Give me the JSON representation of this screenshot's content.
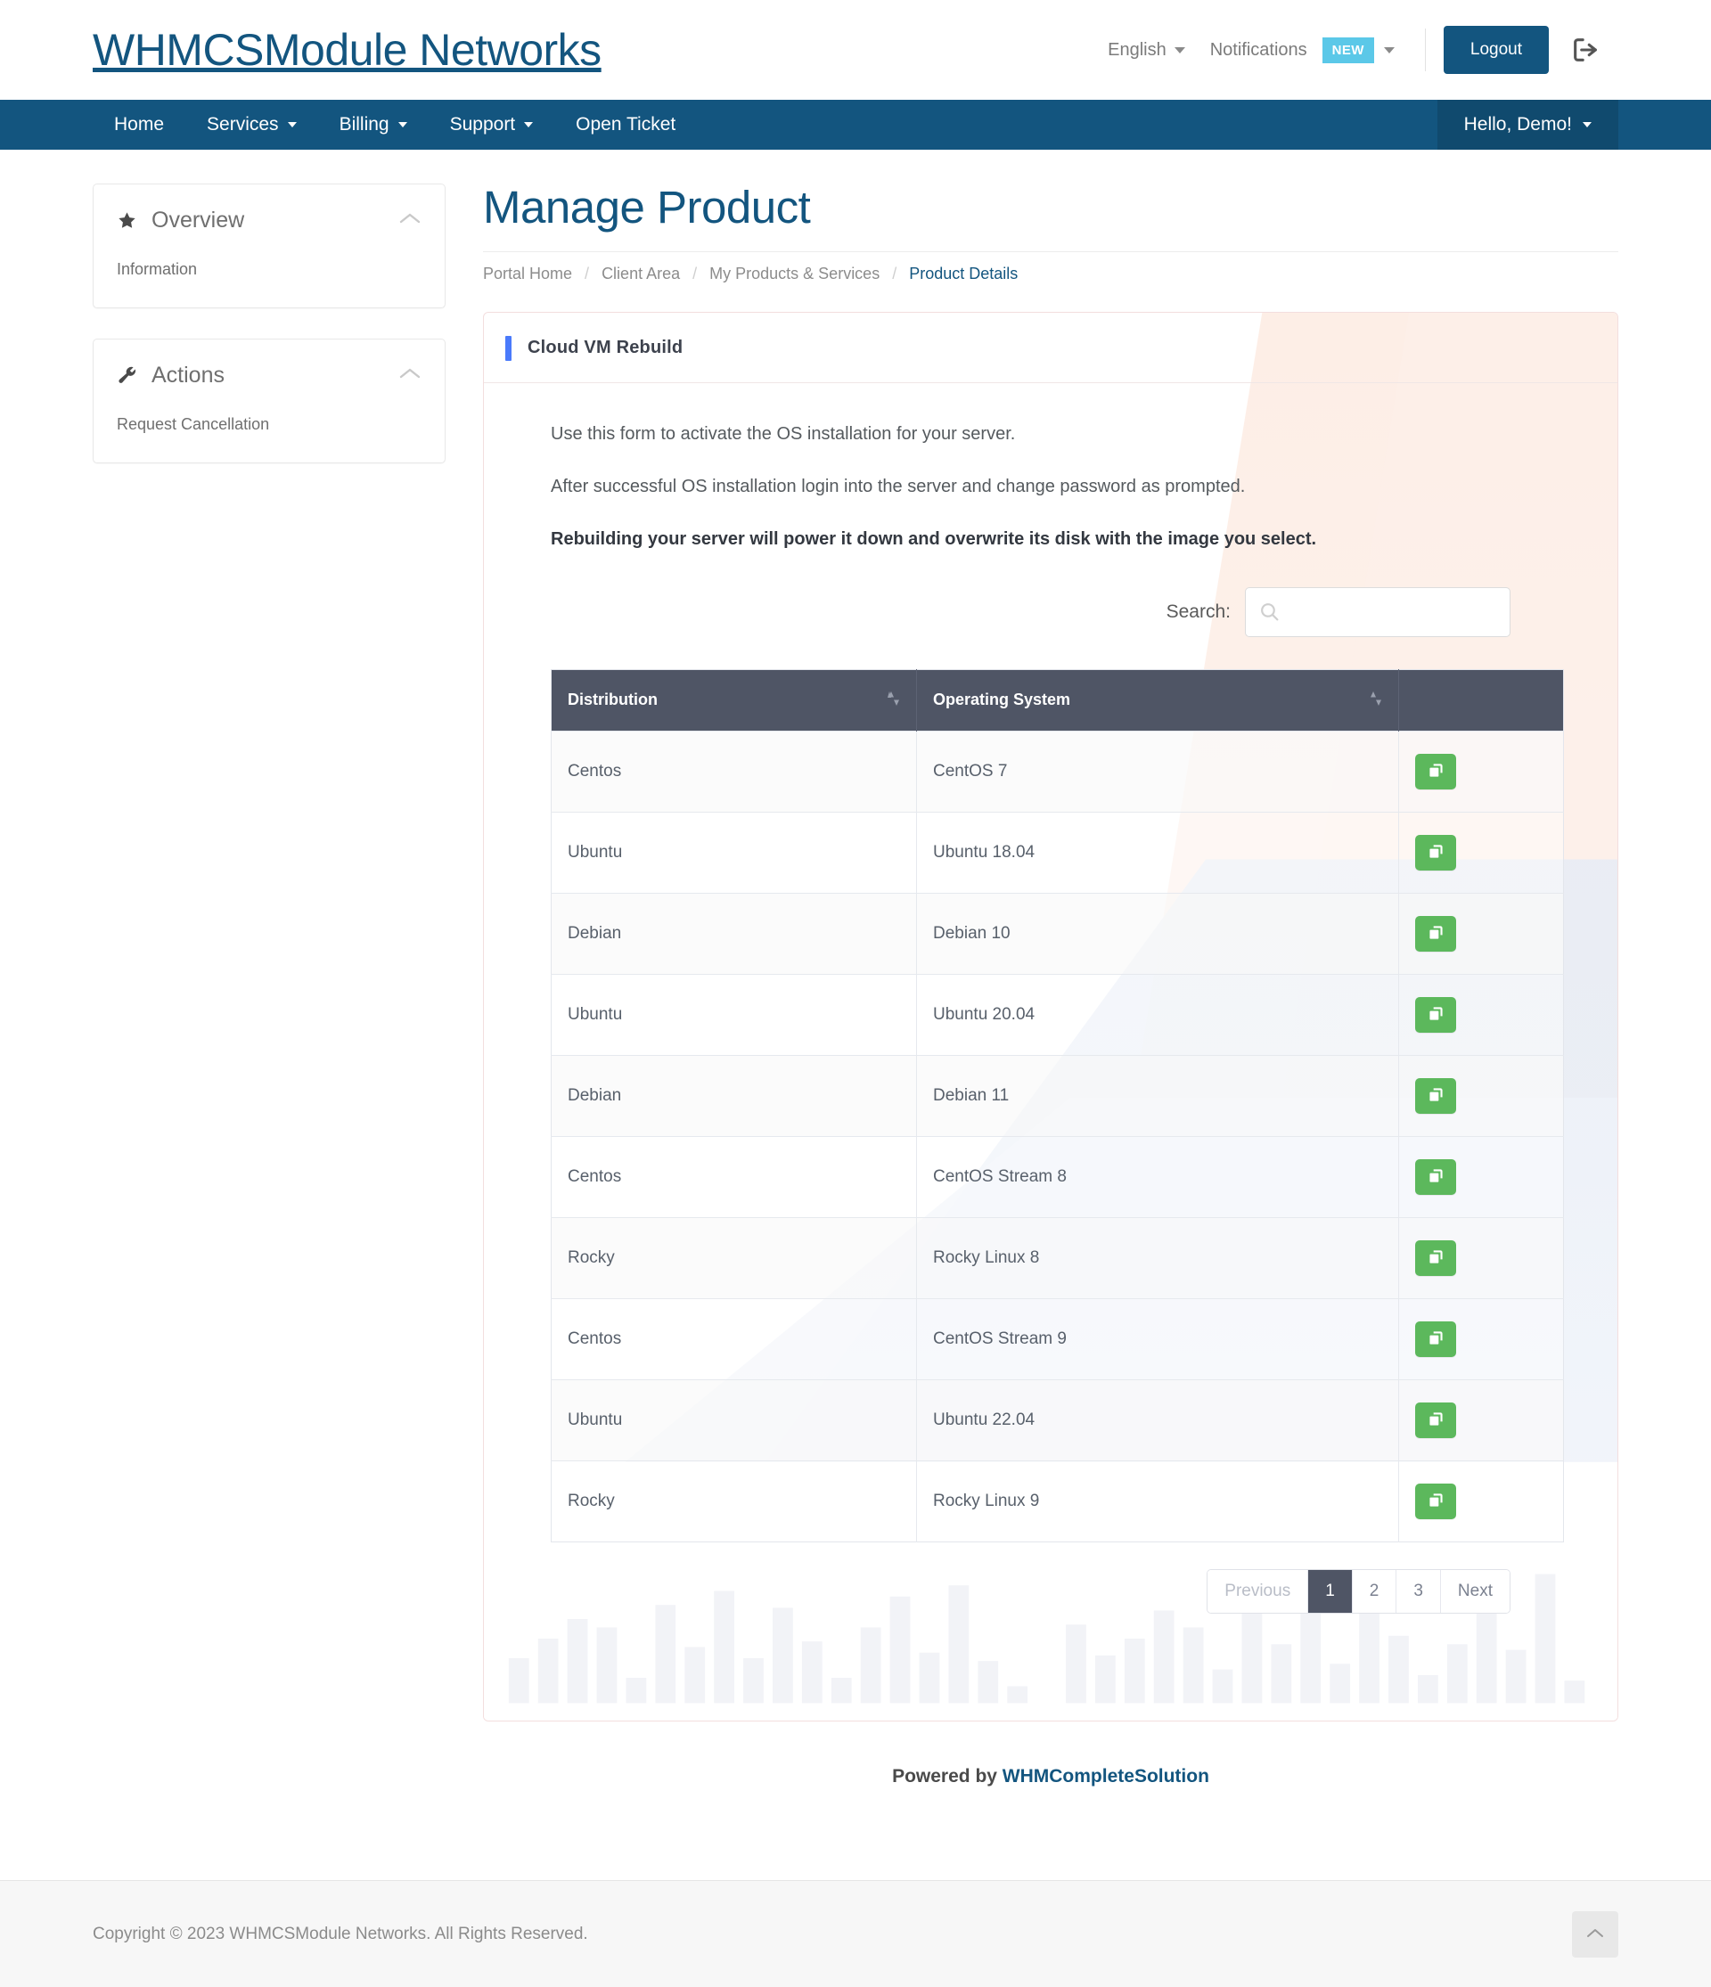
{
  "header": {
    "brand": "WHMCSModule Networks",
    "language_label": "English",
    "notifications_label": "Notifications",
    "notifications_badge": "NEW",
    "logout_label": "Logout",
    "logout_icon": "sign-out-icon"
  },
  "nav": {
    "items": [
      {
        "label": "Home",
        "caret": false
      },
      {
        "label": "Services",
        "caret": true
      },
      {
        "label": "Billing",
        "caret": true
      },
      {
        "label": "Support",
        "caret": true
      },
      {
        "label": "Open Ticket",
        "caret": false
      }
    ],
    "user_label": "Hello, Demo!"
  },
  "sidebar": {
    "panels": [
      {
        "title": "Overview",
        "icon": "star-icon",
        "collapse_icon": "chevron-up-icon",
        "links": [
          "Information"
        ]
      },
      {
        "title": "Actions",
        "icon": "wrench-icon",
        "collapse_icon": "chevron-up-icon",
        "links": [
          "Request Cancellation"
        ]
      }
    ]
  },
  "main": {
    "page_title": "Manage Product",
    "breadcrumb": [
      {
        "label": "Portal Home",
        "active": false
      },
      {
        "label": "Client Area",
        "active": false
      },
      {
        "label": "My Products & Services",
        "active": false
      },
      {
        "label": "Product Details",
        "active": true
      }
    ],
    "breadcrumb_separator": "/"
  },
  "panel": {
    "title": "Cloud VM Rebuild",
    "accent_color": "#4a7afb",
    "intro": [
      "Use this form to activate the OS installation for your server.",
      "After successful OS installation login into the server and change password as prompted."
    ],
    "warning": "Rebuilding your server will power it down and overwrite its disk with the image you select.",
    "search": {
      "label": "Search:",
      "value": "",
      "placeholder": "",
      "icon": "search-icon"
    },
    "table": {
      "columns": [
        {
          "label": "Distribution",
          "sortable": true,
          "sort_icon": "sort-icon"
        },
        {
          "label": "Operating System",
          "sortable": true,
          "sort_icon": "sort-icon"
        },
        {
          "label": "",
          "sortable": false
        }
      ],
      "rows": [
        {
          "distribution": "Centos",
          "os": "CentOS 7",
          "action_icon": "clone-icon"
        },
        {
          "distribution": "Ubuntu",
          "os": "Ubuntu 18.04",
          "action_icon": "clone-icon"
        },
        {
          "distribution": "Debian",
          "os": "Debian 10",
          "action_icon": "clone-icon"
        },
        {
          "distribution": "Ubuntu",
          "os": "Ubuntu 20.04",
          "action_icon": "clone-icon"
        },
        {
          "distribution": "Debian",
          "os": "Debian 11",
          "action_icon": "clone-icon"
        },
        {
          "distribution": "Centos",
          "os": "CentOS Stream 8",
          "action_icon": "clone-icon"
        },
        {
          "distribution": "Rocky",
          "os": "Rocky Linux 8",
          "action_icon": "clone-icon"
        },
        {
          "distribution": "Centos",
          "os": "CentOS Stream 9",
          "action_icon": "clone-icon"
        },
        {
          "distribution": "Ubuntu",
          "os": "Ubuntu 22.04",
          "action_icon": "clone-icon"
        },
        {
          "distribution": "Rocky",
          "os": "Rocky Linux 9",
          "action_icon": "clone-icon"
        }
      ]
    },
    "pagination": {
      "previous_label": "Previous",
      "pages": [
        "1",
        "2",
        "3"
      ],
      "active_page": "1",
      "next_label": "Next"
    }
  },
  "footer": {
    "powered_prefix": "Powered by ",
    "powered_link": "WHMCompleteSolution",
    "copyright": "Copyright © 2023 WHMCSModule Networks. All Rights Reserved.",
    "to_top_icon": "chevron-up-icon"
  }
}
